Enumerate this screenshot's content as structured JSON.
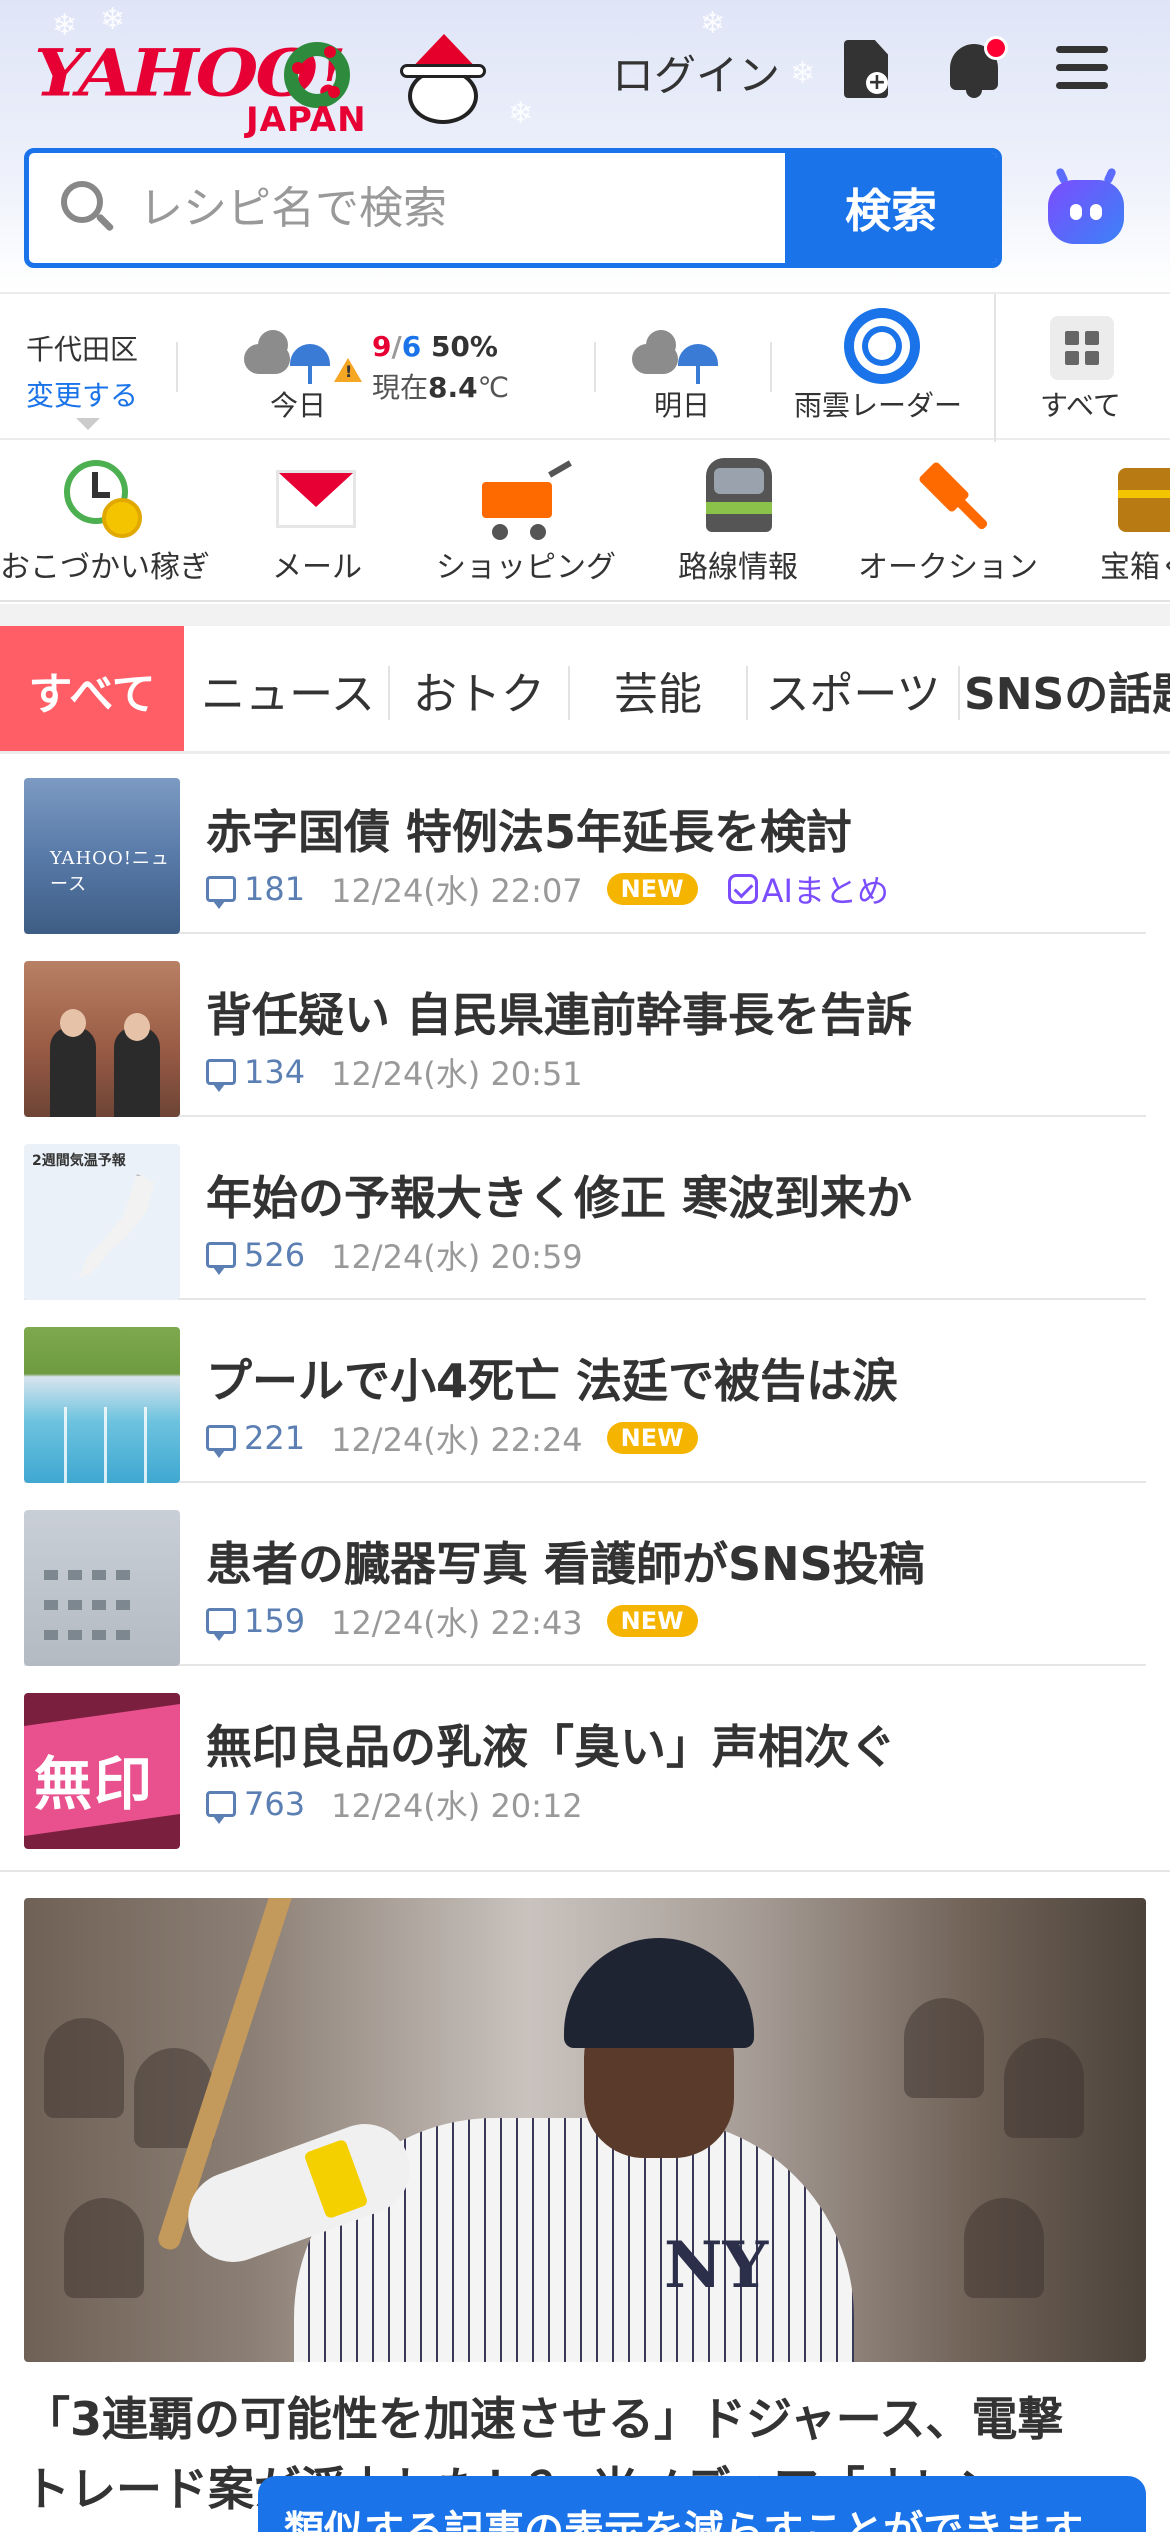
{
  "header": {
    "logo_text": "YAHOO!",
    "logo_sub": "JAPAN",
    "login_label": "ログイン",
    "icons": [
      "doc-plus-icon",
      "bell-icon",
      "hamburger-menu-icon"
    ]
  },
  "search": {
    "placeholder": "レシピ名で検索",
    "button_label": "検索"
  },
  "weather": {
    "location": "千代田区",
    "change_label": "変更する",
    "today": {
      "label": "今日",
      "high": "9",
      "slash": "/",
      "low": "6",
      "pop": "50%",
      "now_label": "現在",
      "now_temp": "8.4",
      "unit": "℃"
    },
    "tomorrow": {
      "label": "明日"
    },
    "radar_label": "雨雲レーダー",
    "all_label": "すべて"
  },
  "services": [
    {
      "label": "おこづかい稼ぎ",
      "icon": "clock-coin-icon"
    },
    {
      "label": "メール",
      "icon": "mail-icon"
    },
    {
      "label": "ショッピング",
      "icon": "cart-icon"
    },
    {
      "label": "路線情報",
      "icon": "train-icon"
    },
    {
      "label": "オークション",
      "icon": "gavel-icon"
    },
    {
      "label": "宝箱く",
      "icon": "treasure-icon"
    }
  ],
  "tabs": [
    "すべて",
    "ニュース",
    "おトク",
    "芸能",
    "スポーツ",
    "SNSの話題"
  ],
  "news": [
    {
      "title": "赤字国債 特例法5年延長を検討",
      "comments": "181",
      "time": "12/24(水) 22:07",
      "new": "NEW",
      "ai": "AIまとめ",
      "thumb_text": "YAHOO!ニュース"
    },
    {
      "title": "背任疑い 自民県連前幹事長を告訴",
      "comments": "134",
      "time": "12/24(水) 20:51"
    },
    {
      "title": "年始の予報大きく修正 寒波到来か",
      "comments": "526",
      "time": "12/24(水) 20:59",
      "thumb_text": "2週間気温予報"
    },
    {
      "title": "プールで小4死亡 法廷で被告は涙",
      "comments": "221",
      "time": "12/24(水) 22:24",
      "new": "NEW"
    },
    {
      "title": "患者の臓器写真 看護師がSNS投稿",
      "comments": "159",
      "time": "12/24(水) 22:43",
      "new": "NEW"
    },
    {
      "title": "無印良品の乳液「臭い」声相次ぐ",
      "comments": "763",
      "time": "12/24(水) 20:12",
      "thumb_text": "無印"
    }
  ],
  "feature": {
    "title_line1": "「3連覇の可能性を加速させる」ドジャース、電撃",
    "title_line2": "トレード案が浮上した！？ 米メディア「オレン",
    "jersey_text": "NY"
  },
  "toast": {
    "text": "類似する記事の表示を減らすことができます"
  },
  "colors": {
    "accent": "#1a73e8",
    "brand_red": "#e60033",
    "active_tab": "#ff5e66",
    "new_badge": "#f5b400"
  }
}
